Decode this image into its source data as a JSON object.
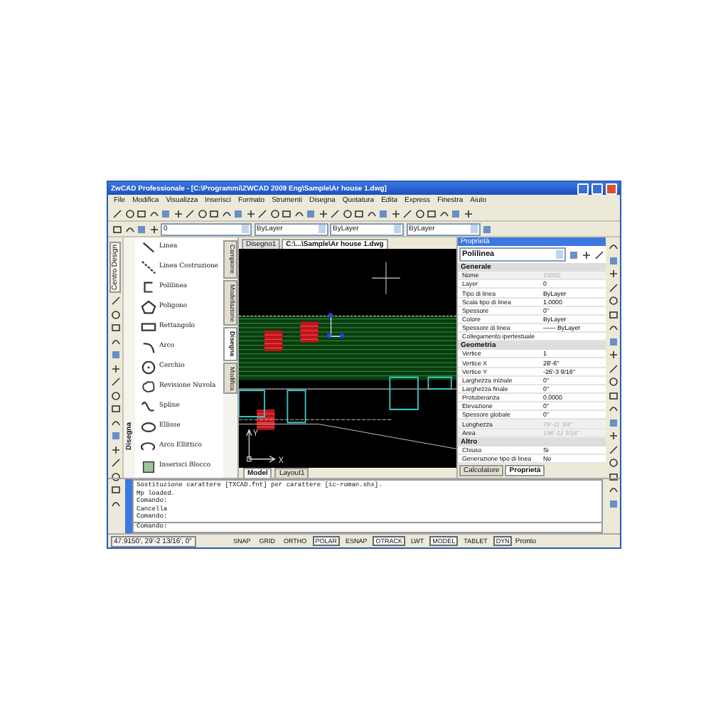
{
  "window": {
    "title": "ZwCAD Professionale - [C:\\Programmi\\ZWCAD 2009 Eng\\Sample\\Ar house 1.dwg]"
  },
  "menu": [
    "File",
    "Modifica",
    "Visualizza",
    "Inserisci",
    "Formato",
    "Strumenti",
    "Disegna",
    "Quotatura",
    "Edita",
    "Express",
    "Finestra",
    "Aiuto"
  ],
  "layer_toolbar": {
    "layer": "0",
    "colour": "ByLayer",
    "linetype": "ByLayer",
    "lineweight": "ByLayer"
  },
  "palette": {
    "side_label": "Centro Design",
    "title": "Disegna",
    "items": [
      "Linea",
      "Linea Costruzione",
      "Polilinea",
      "Poligono",
      "Rettangolo",
      "Arco",
      "Cerchio",
      "Revisione Nuvola",
      "Spline",
      "Ellisse",
      "Arco Ellittico",
      "Inserisci Blocco"
    ],
    "tabs": [
      {
        "label": "Campione",
        "selected": false
      },
      {
        "label": "Modellazione",
        "selected": false
      },
      {
        "label": "Disegna",
        "selected": true
      },
      {
        "label": "Modifica",
        "selected": false
      }
    ]
  },
  "document_tabs": [
    {
      "label": "Disegno1",
      "selected": false
    },
    {
      "label": "C:\\...\\Sample\\Ar house 1.dwg",
      "selected": true
    }
  ],
  "drawing": {
    "x_axis": "X",
    "y_axis": "Y"
  },
  "layout_tabs": [
    {
      "label": "Model",
      "selected": true
    },
    {
      "label": "Layout1",
      "selected": false
    }
  ],
  "properties": {
    "title": "Proprietà",
    "object_type": "Polilinea",
    "sections": [
      {
        "name": "Generale",
        "rows": [
          {
            "label": "Nome",
            "value": "15002",
            "disabled": true
          },
          {
            "label": "Layer",
            "value": "0",
            "disabled": false
          },
          {
            "label": "Tipo di linea",
            "value": "ByLayer",
            "disabled": false
          },
          {
            "label": "Scala tipo di linea",
            "value": "1.0000",
            "disabled": false
          },
          {
            "label": "Spessore",
            "value": "0\"",
            "disabled": false
          },
          {
            "label": "Colore",
            "value": "ByLayer",
            "disabled": false
          },
          {
            "label": "Spessore di linea",
            "value": "—— ByLayer",
            "disabled": false
          },
          {
            "label": "Collegamento ipertestuale",
            "value": "",
            "disabled": false
          }
        ]
      },
      {
        "name": "Geometria",
        "rows": [
          {
            "label": "Vertice",
            "value": "1",
            "disabled": false
          },
          {
            "label": "Vertice X",
            "value": "28'-6\"",
            "disabled": false
          },
          {
            "label": "Vertice Y",
            "value": "-26'-3 9/16\"",
            "disabled": false
          },
          {
            "label": "Larghezza iniziale",
            "value": "0\"",
            "disabled": false
          },
          {
            "label": "Larghezza finale",
            "value": "0\"",
            "disabled": false
          },
          {
            "label": "Protuberanza",
            "value": "0.0000",
            "disabled": false
          },
          {
            "label": "Elevazione",
            "value": "0\"",
            "disabled": false
          },
          {
            "label": "Spessore globale",
            "value": "0\"",
            "disabled": false
          },
          {
            "label": "Lunghezza",
            "value": "76'-11 3/4\"",
            "disabled": true
          },
          {
            "label": "Area",
            "value": "196'-11 3/16\"",
            "disabled": true
          }
        ]
      },
      {
        "name": "Altro",
        "rows": [
          {
            "label": "Chiuso",
            "value": "Si",
            "disabled": false
          },
          {
            "label": "Generazione tipo di linea",
            "value": "No",
            "disabled": false
          }
        ]
      }
    ],
    "tabs": [
      {
        "label": "Calcolatore",
        "selected": false
      },
      {
        "label": "Proprietà",
        "selected": true
      }
    ]
  },
  "command": {
    "history": [
      "Sostituzione carattere [TXCAD.fnt] per carattere [ic-roman.shx].",
      "Mp loaded.",
      "Comando:",
      "Cancella",
      "Comando:"
    ],
    "prompt": "Comando:"
  },
  "status_bar": {
    "coordinates": "47.9150', 29'-2 13/16', 0\"",
    "toggles": [
      {
        "label": "SNAP",
        "on": false
      },
      {
        "label": "GRID",
        "on": false
      },
      {
        "label": "ORTHO",
        "on": false
      },
      {
        "label": "POLAR",
        "on": true
      },
      {
        "label": "ESNAP",
        "on": false
      },
      {
        "label": "OTRACK",
        "on": true
      },
      {
        "label": "LWT",
        "on": false
      },
      {
        "label": "MODEL",
        "on": true
      },
      {
        "label": "TABLET",
        "on": false
      },
      {
        "label": "DYN",
        "on": true
      }
    ],
    "message": "Pronto"
  }
}
